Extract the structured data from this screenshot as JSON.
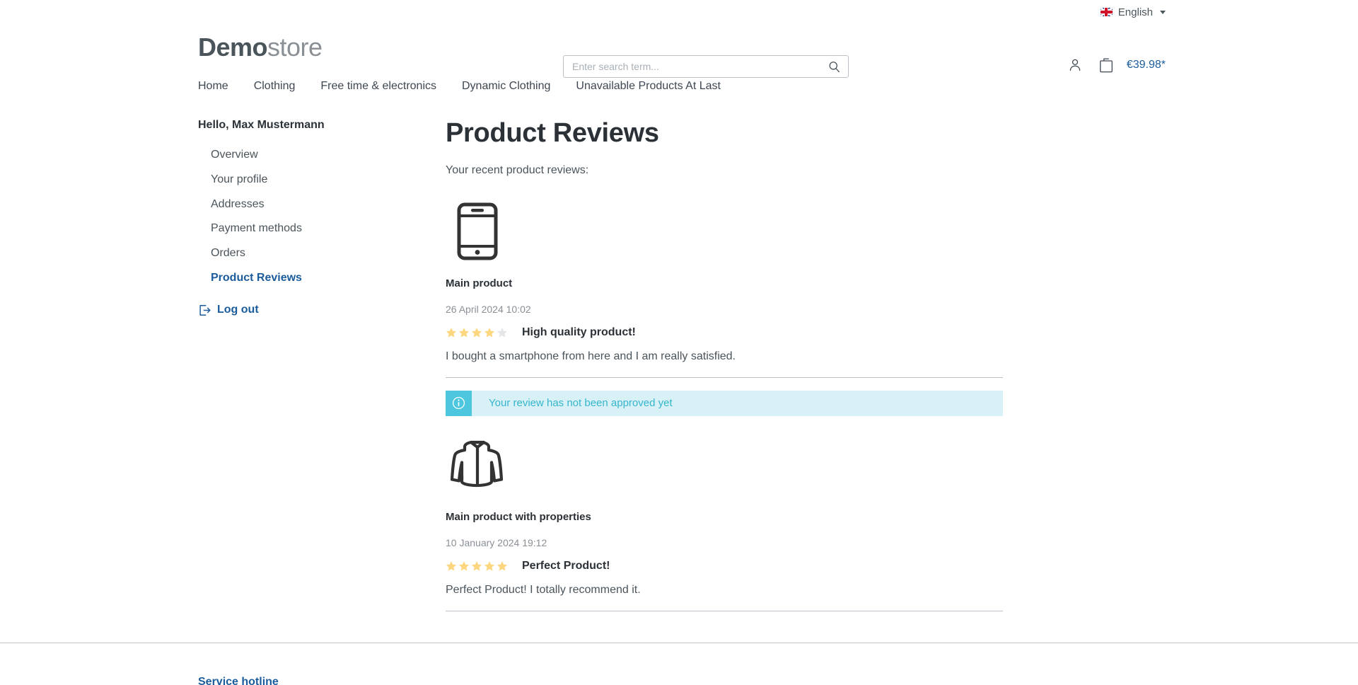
{
  "topbar": {
    "language": "English",
    "flag_icon": "uk-flag-icon",
    "caret_icon": "chevron-down-icon"
  },
  "header": {
    "logo_bold": "Demo",
    "logo_light": "store",
    "search": {
      "placeholder": "Enter search term...",
      "value": "",
      "icon": "search-icon"
    },
    "account_icon": "user-icon",
    "cart_icon": "shopping-bag-icon",
    "cart_total": "€39.98*"
  },
  "nav": {
    "items": [
      {
        "label": "Home"
      },
      {
        "label": "Clothing"
      },
      {
        "label": "Free time & electronics"
      },
      {
        "label": "Dynamic Clothing"
      },
      {
        "label": "Unavailable Products At Last"
      }
    ]
  },
  "sidebar": {
    "greeting": "Hello, Max Mustermann",
    "items": [
      {
        "label": "Overview",
        "active": false
      },
      {
        "label": "Your profile",
        "active": false
      },
      {
        "label": "Addresses",
        "active": false
      },
      {
        "label": "Payment methods",
        "active": false
      },
      {
        "label": "Orders",
        "active": false
      },
      {
        "label": "Product Reviews",
        "active": true
      }
    ],
    "logout": {
      "label": "Log out",
      "icon": "logout-icon"
    }
  },
  "main": {
    "title": "Product Reviews",
    "subtitle": "Your recent product reviews:",
    "reviews": [
      {
        "product_image_icon": "smartphone-icon",
        "product_name": "Main product",
        "date": "26 April 2024 10:02",
        "rating": 4,
        "max_rating": 5,
        "headline": "High quality product!",
        "body": "I bought a smartphone from here and I am really satisfied.",
        "alert": {
          "icon": "info-icon",
          "text": "Your review has not been approved yet"
        }
      },
      {
        "product_image_icon": "jacket-icon",
        "product_name": "Main product with properties",
        "date": "10 January 2024 19:12",
        "rating": 5,
        "max_rating": 5,
        "headline": "Perfect Product!",
        "body": "Perfect Product! I totally recommend it.",
        "alert": null
      }
    ]
  },
  "footer": {
    "column_title": "Service hotline"
  },
  "colors": {
    "link_blue": "#1b5c9c",
    "star_filled": "#fcd77f",
    "star_empty": "#e4e7ea",
    "info_bg": "#d8f1f6",
    "info_accent": "#4dc7de",
    "info_text": "#36b5cf",
    "text_dark": "#2b3136",
    "text_body": "#4a545b",
    "muted": "#8a9096",
    "border": "#bcc1c7"
  }
}
